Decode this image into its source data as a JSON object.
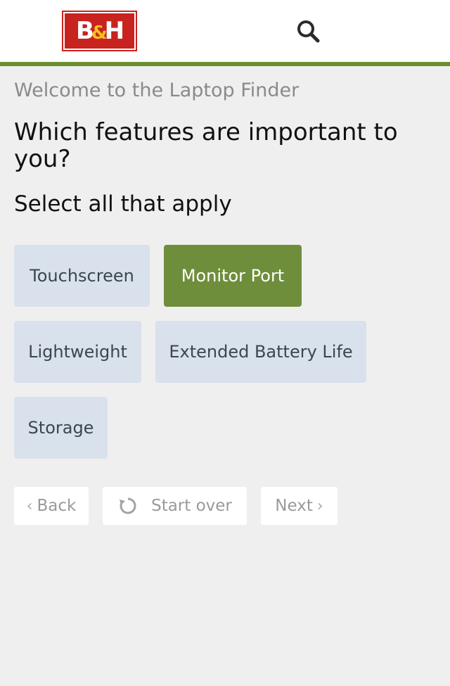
{
  "header": {
    "logo_text_left": "B",
    "logo_amp": "&",
    "logo_text_right": "H",
    "search_icon": "search-icon"
  },
  "intro": {
    "welcome": "Welcome to the Laptop Finder",
    "question": "Which features are important to you?",
    "instruction": "Select all that apply"
  },
  "options": [
    {
      "label": "Touchscreen",
      "selected": false
    },
    {
      "label": "Monitor Port",
      "selected": true
    },
    {
      "label": "Lightweight",
      "selected": false
    },
    {
      "label": "Extended Battery Life",
      "selected": false
    },
    {
      "label": "Storage",
      "selected": false
    }
  ],
  "nav": {
    "back_label": "Back",
    "start_over_label": "Start over",
    "next_label": "Next"
  },
  "colors": {
    "brand_red": "#c8231f",
    "accent_green": "#6b8e2f",
    "option_bg": "#d8e1ec",
    "option_selected_bg": "#6f8e3b"
  }
}
